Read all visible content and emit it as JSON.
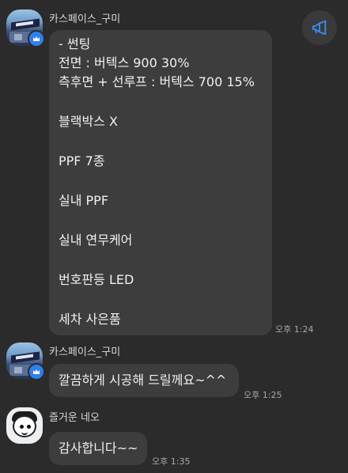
{
  "messages": [
    {
      "sender": "카스페이스_구미",
      "lines": [
        "- 썬팅",
        "전면 : 버텍스 900 30%",
        "측후면 + 선루프 : 버텍스 700 15%",
        "",
        "블랙박스 X",
        "",
        "PPF 7종",
        "",
        "실내 PPF",
        "",
        "실내 연무케어",
        "",
        "번호판등 LED",
        "",
        "세차 사은품"
      ],
      "time": "오후 1:24"
    },
    {
      "sender": "카스페이스_구미",
      "text": "깔끔하게 시공해 드릴께요~^^",
      "time": "오후 1:25"
    },
    {
      "sender": "즐거운 네오",
      "text": "감사합니다~~",
      "time": "오후 1:35"
    }
  ],
  "icons": {
    "announce": "megaphone-icon",
    "host_badge": "crown-icon"
  },
  "colors": {
    "background": "#2b2b2b",
    "bubble": "#3d3d3d",
    "accent": "#2f80ed"
  }
}
